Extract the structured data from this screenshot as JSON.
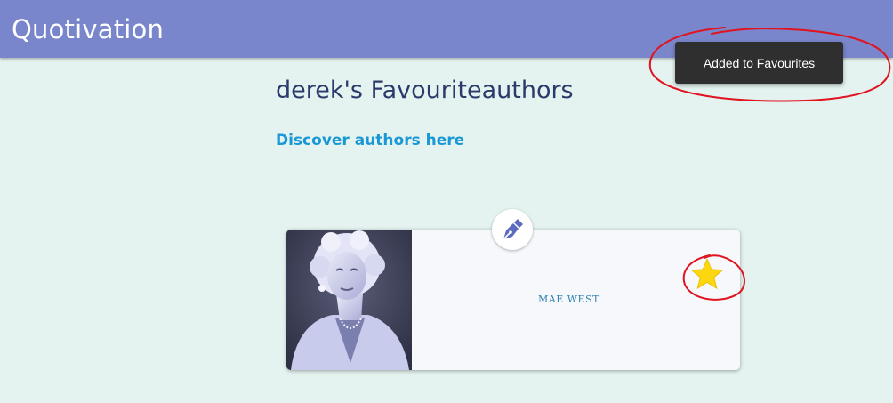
{
  "app": {
    "title": "Quotivation",
    "accent_color": "#7986cb",
    "background_color": "#e4f3f0"
  },
  "main": {
    "page_title": "derek's Favouriteauthors",
    "discover_link": "Discover authors here"
  },
  "authors": [
    {
      "name": "MAE WEST",
      "favourited": true,
      "star_color": "#fcd60f"
    }
  ],
  "edit_button": {
    "icon": "pen-nib-icon"
  },
  "toast": {
    "message": "Added to Favourites"
  },
  "annotations": {
    "color": "#e0131f"
  }
}
